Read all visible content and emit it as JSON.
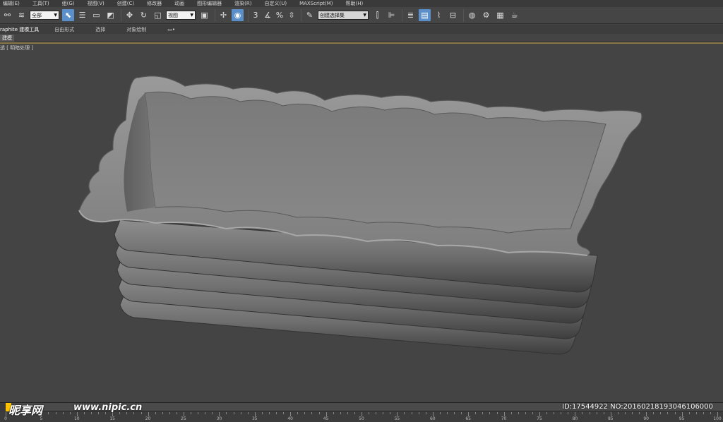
{
  "menu": [
    "编辑(E)",
    "工具(T)",
    "组(G)",
    "视图(V)",
    "创建(C)",
    "修改器",
    "动画",
    "图形编辑器",
    "渲染(R)",
    "自定义(U)",
    "MAXScript(M)",
    "帮助(H)"
  ],
  "toolbar": {
    "selection_filter": "全部",
    "reference_coord": "视图",
    "named_selection": "创建选择集",
    "snaps_label": "3",
    "angle_snap_label": "%"
  },
  "ribbon": {
    "tabs": [
      "raphite 建模工具",
      "自由形式",
      "选择",
      "对象绘制"
    ],
    "sub_label": "建模"
  },
  "viewport": {
    "label": "透 [ 明暗处理 ]"
  },
  "timeline": {
    "ticks": [
      "0",
      "5",
      "10",
      "15",
      "20",
      "25",
      "30",
      "35",
      "40",
      "45",
      "50",
      "55",
      "60",
      "65",
      "70",
      "75",
      "80",
      "85",
      "90",
      "95",
      "100"
    ]
  },
  "watermark": {
    "logo": "昵享网",
    "url": "www.nipic.cn",
    "id": "ID:17544922 NO:20160218193046106000"
  },
  "colors": {
    "accent": "#5b8fc9",
    "timeline_knob": "#ffc200",
    "viewport_bg": "#444444",
    "model": "#8a8a8a"
  }
}
